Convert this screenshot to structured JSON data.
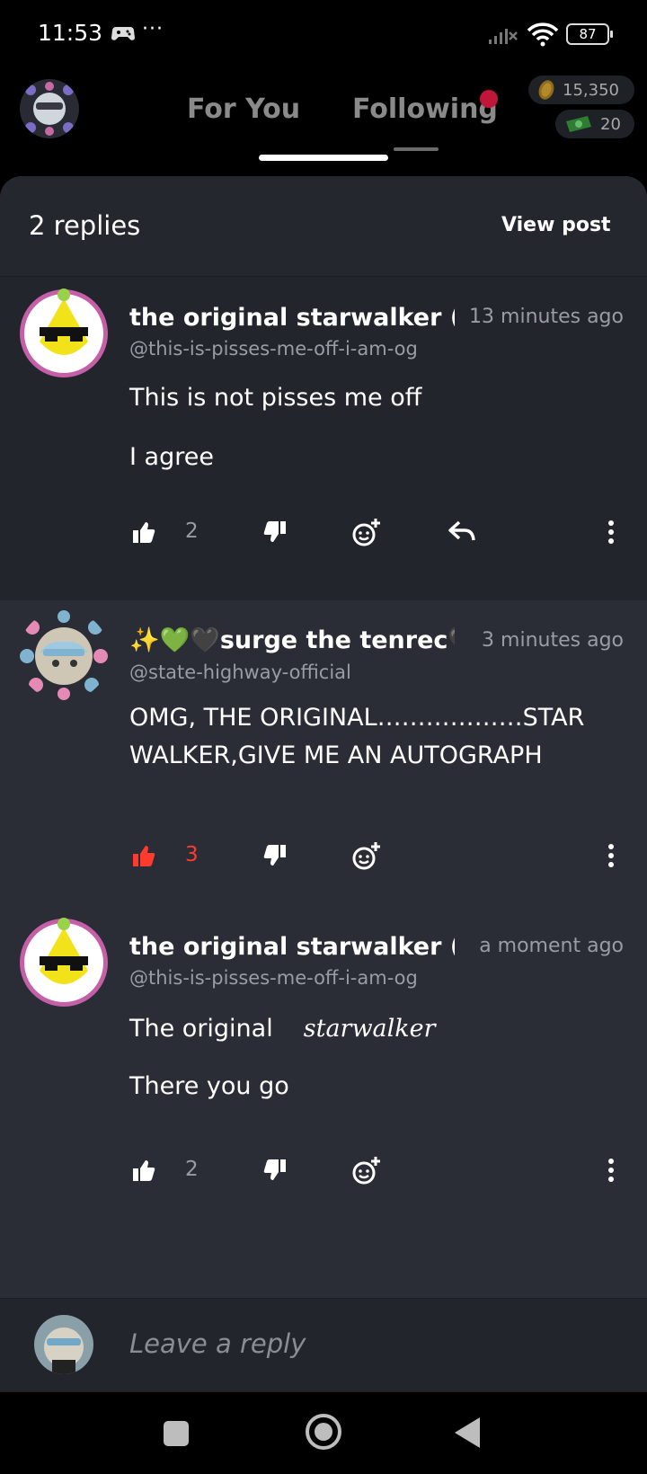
{
  "status_bar": {
    "time": "11:53",
    "more": "···",
    "battery": "87",
    "icons": [
      "game-controller-icon",
      "signal-icon",
      "wifi-icon",
      "battery-icon"
    ]
  },
  "top_nav": {
    "tabs": [
      {
        "label": "For You",
        "active": true
      },
      {
        "label": "Following",
        "active": false,
        "has_notification": true
      }
    ],
    "coins": "15,350",
    "gems": "20"
  },
  "panel": {
    "replies_label": "2 replies",
    "view_post_label": "View post"
  },
  "comments": [
    {
      "author": "the original  starwalker (",
      "handle": "@this-is-pisses-me-off-i-am-og",
      "time": "13 minutes ago",
      "lines": [
        "This is not pisses me off",
        "I agree"
      ],
      "likes": "2",
      "liked": false
    },
    {
      "author": "✨💚🖤surge the tenrec🖤",
      "handle": "@state-highway-official",
      "time": "3 minutes ago",
      "lines": [
        "OMG, THE ORIGINAL………………STAR WALKER,GIVE ME AN AUTOGRAPH"
      ],
      "likes": "3",
      "liked": true
    },
    {
      "author": "the original  starwalker (r",
      "handle": "@this-is-pisses-me-off-i-am-og",
      "time": "a moment ago",
      "lines": [
        "The original",
        "starwalker",
        "There you go"
      ],
      "likes": "2",
      "liked": false
    }
  ],
  "reply_bar": {
    "placeholder": "Leave a reply"
  },
  "colors": {
    "background": "#000000",
    "panel": "#2b2d36",
    "parent_comment": "#23252d",
    "accent_like": "#ff3b30",
    "muted_text": "#9a9ca4",
    "notification": "#c0163a"
  }
}
